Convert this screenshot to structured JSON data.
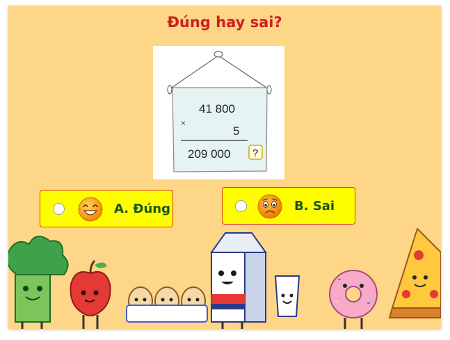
{
  "question": {
    "title": "Đúng hay sai?"
  },
  "problem": {
    "multiplicand": "41 800",
    "operator": "×",
    "multiplier": "5",
    "result": "209 000",
    "check_mark": "?"
  },
  "options": [
    {
      "label": "A. Đúng",
      "icon": "laughing-face-icon"
    },
    {
      "label": "B. Sai",
      "icon": "worried-face-icon"
    }
  ],
  "colors": {
    "background": "#fdd687",
    "title": "#cc1f1f",
    "option_fill": "#fffe00",
    "option_border": "#d63b2a",
    "option_text": "#18551c"
  },
  "decorations": [
    "broccoli-character",
    "apple-character",
    "eggs-character",
    "milk-carton-character",
    "milk-glass-character",
    "donut-character",
    "pizza-character"
  ]
}
